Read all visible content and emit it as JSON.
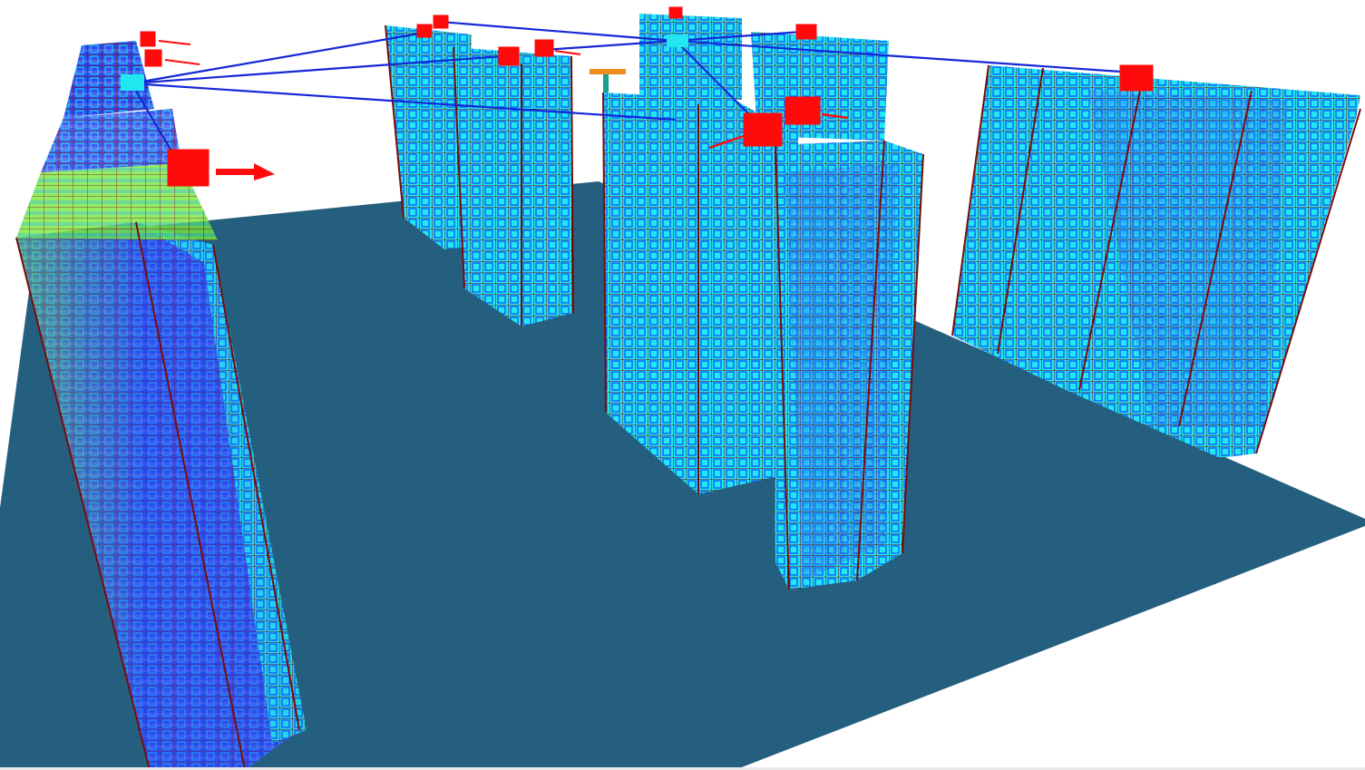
{
  "app": {
    "title": ""
  },
  "colors": {
    "background": "#ffffff",
    "ground": "#255f7f",
    "frame": "#7a0a0a",
    "panel_cyan": "#22e6f0",
    "panel_blue": "#1836e6",
    "panel_green": "#86f030",
    "window_outline": "#0a55ff",
    "link_line": "#1428d6",
    "marker": "#ff0a0a",
    "axis_orange": "#f08c1e",
    "axis_green": "#18a08c"
  },
  "icons": {
    "marker": "red-cube-load-marker",
    "arrow": "red-force-arrow",
    "axis": "orientation-gizmo-icon",
    "node": "cyan-node-marker"
  },
  "scene": {
    "building_count": 5,
    "marker_count": 12,
    "link_count": 9
  }
}
